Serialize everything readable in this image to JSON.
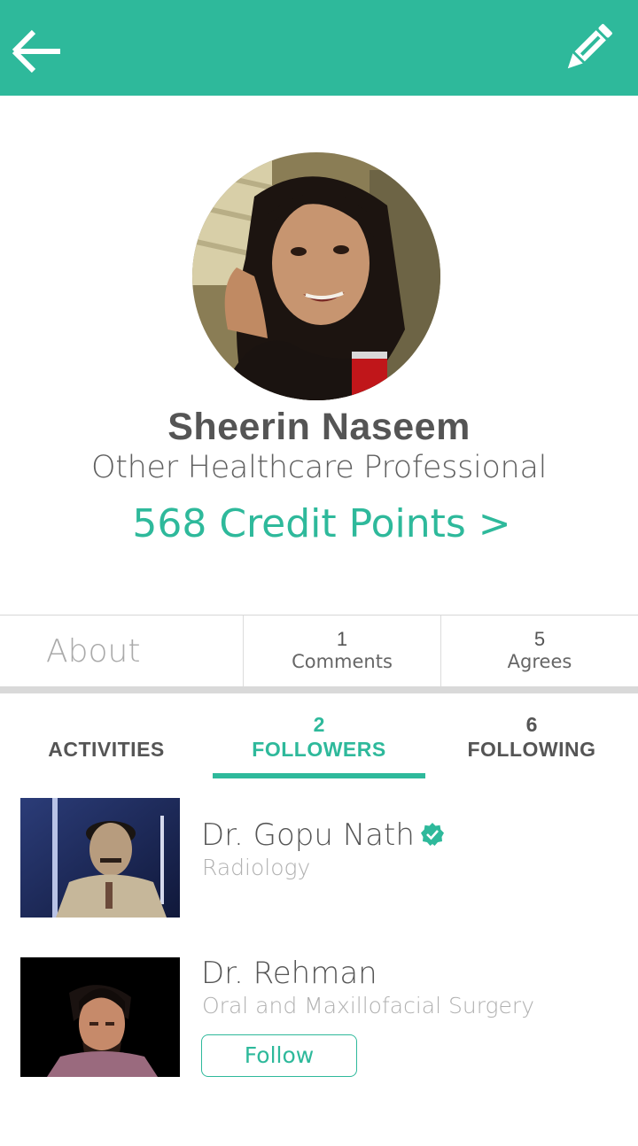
{
  "header": {
    "back_icon": "arrow-left-icon",
    "edit_icon": "pencil-icon",
    "color": "#2eb99b"
  },
  "profile": {
    "name": "Sheerin Naseem",
    "role": "Other Healthcare Professional",
    "credits": "568 Credit Points >"
  },
  "stats": {
    "about_label": "About",
    "comments": {
      "count": "1",
      "label": "Comments"
    },
    "agrees": {
      "count": "5",
      "label": "Agrees"
    }
  },
  "tabs": [
    {
      "count": "",
      "label": "ACTIVITIES"
    },
    {
      "count": "2",
      "label": "FOLLOWERS",
      "active": true
    },
    {
      "count": "6",
      "label": "FOLLOWING"
    }
  ],
  "followers": [
    {
      "name": "Dr. Gopu Nath",
      "specialty": "Radiology",
      "verified": true
    },
    {
      "name": "Dr. Rehman",
      "specialty": "Oral and Maxillofacial Surgery",
      "button_label": "Follow"
    }
  ],
  "colors": {
    "accent": "#2eb99b",
    "text": "#555555",
    "muted": "#b0b0b0"
  }
}
